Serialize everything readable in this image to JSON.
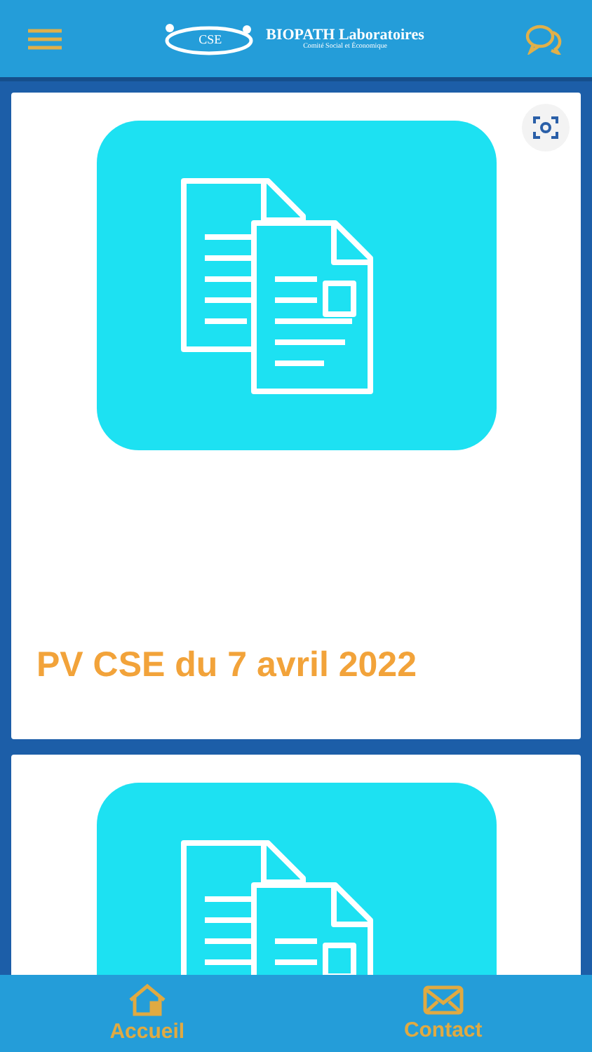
{
  "header": {
    "brand": "BIOPATH Laboratoires",
    "subtitle": "Comité Social et Économique",
    "logo_text": "CSE"
  },
  "cards": [
    {
      "title": "PV CSE du 7 avril 2022",
      "lens": true
    },
    {
      "lens": false
    }
  ],
  "nav": [
    {
      "label": "Accueil",
      "kind": "home"
    },
    {
      "label": "Contact",
      "kind": "mail"
    }
  ]
}
